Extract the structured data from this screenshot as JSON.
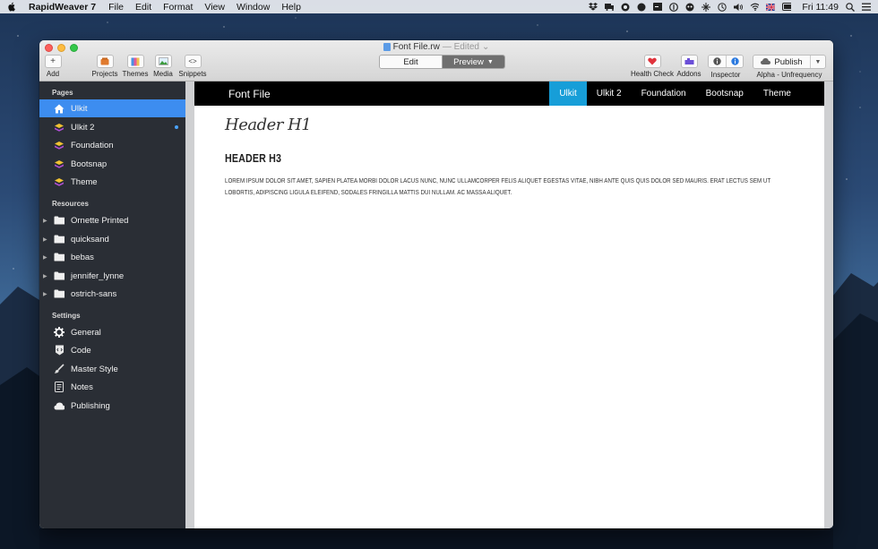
{
  "menubar": {
    "app_name": "RapidWeaver 7",
    "menus": [
      "File",
      "Edit",
      "Format",
      "View",
      "Window",
      "Help"
    ],
    "clock": "Fri 11:49"
  },
  "window": {
    "doc_name": "Font File.rw",
    "doc_state": "— Edited",
    "toolbar": {
      "add": "Add",
      "projects": "Projects",
      "themes": "Themes",
      "media": "Media",
      "snippets": "Snippets",
      "edit": "Edit",
      "preview": "Preview",
      "health_check": "Health Check",
      "addons": "Addons",
      "inspector": "Inspector",
      "publish": "Publish",
      "publish_target": "Alpha - Unfrequency"
    }
  },
  "sidebar": {
    "pages_title": "Pages",
    "pages": [
      {
        "label": "Ulkit",
        "icon": "home-icon",
        "selected": true
      },
      {
        "label": "Ulkit 2",
        "icon": "stack-icon",
        "badge": true
      },
      {
        "label": "Foundation",
        "icon": "stack-icon"
      },
      {
        "label": "Bootsnap",
        "icon": "stack-icon"
      },
      {
        "label": "Theme",
        "icon": "stack-icon"
      }
    ],
    "resources_title": "Resources",
    "resources": [
      {
        "label": "Ornette Printed"
      },
      {
        "label": "quicksand"
      },
      {
        "label": "bebas"
      },
      {
        "label": "jennifer_lynne"
      },
      {
        "label": "ostrich-sans"
      }
    ],
    "settings_title": "Settings",
    "settings": [
      {
        "label": "General",
        "icon": "gear-icon"
      },
      {
        "label": "Code",
        "icon": "code-icon"
      },
      {
        "label": "Master Style",
        "icon": "brush-icon"
      },
      {
        "label": "Notes",
        "icon": "notes-icon"
      },
      {
        "label": "Publishing",
        "icon": "cloud-icon"
      }
    ]
  },
  "preview": {
    "brand": "Font File",
    "nav_links": [
      "Ulkit",
      "Ulkit 2",
      "Foundation",
      "Bootsnap",
      "Theme"
    ],
    "active_link": "Ulkit",
    "h1": "Header H1",
    "h3": "HEADER H3",
    "body": "Lorem ipsum dolor sit amet, sapien platea morbi dolor lacus nunc, nunc ullamcorper felis aliquet egestas vitae, nibh ante quis quis dolor sed mauris. Erat lectus sem ut lobortis, adipiscing ligula eleifend, sodales fringilla mattis dui nullam. Ac massa aliquet."
  },
  "colors": {
    "sidebar_bg": "#2a2e35",
    "selected_blue": "#3d8df0",
    "site_nav_bg": "#000000",
    "active_nav": "#179ed8"
  }
}
